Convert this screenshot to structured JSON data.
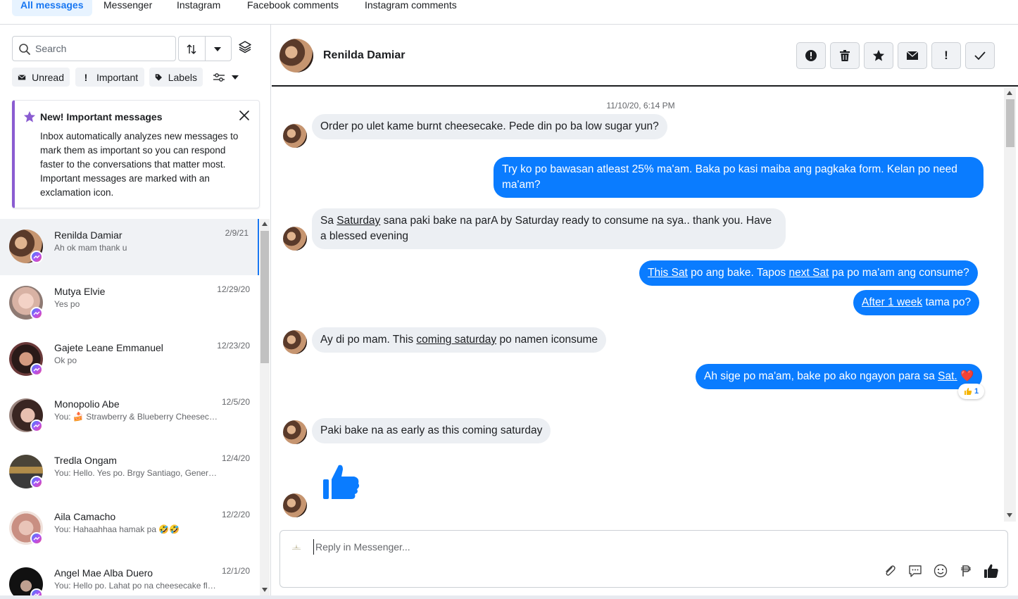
{
  "tabs": [
    "All messages",
    "Messenger",
    "Instagram",
    "Facebook comments",
    "Instagram comments"
  ],
  "search": {
    "placeholder": "Search"
  },
  "filters": {
    "unread": "Unread",
    "important": "Important",
    "labels": "Labels"
  },
  "banner": {
    "title": "New! Important messages",
    "text": "Inbox automatically analyzes new messages to mark them as important so you can respond faster to the conversations that matter most. Important messages are marked with an exclamation icon."
  },
  "conversations": [
    {
      "name": "Renilda Damiar",
      "preview": "Ah ok mam thank u",
      "date": "2/9/21"
    },
    {
      "name": "Mutya Elvie",
      "preview": "Yes po",
      "date": "12/29/20"
    },
    {
      "name": "Gajete Leane Emmanuel",
      "preview": "Ok po",
      "date": "12/23/20"
    },
    {
      "name": "Monopolio Abe",
      "preview": "You: 🍰 Strawberry & Blueberry Cheesecake",
      "date": "12/5/20"
    },
    {
      "name": "Tredla Ongam",
      "preview": "You: Hello. Yes po. Brgy Santiago, General Trias",
      "date": "12/4/20"
    },
    {
      "name": "Aila Camacho",
      "preview": "You: Hahaahhaa hamak pa 🤣🤣",
      "date": "12/2/20"
    },
    {
      "name": "Angel Mae Alba Duero",
      "preview": "You: Hello po. Lahat po na cheesecake flavors",
      "date": "12/1/20"
    }
  ],
  "header": {
    "name": "Renilda Damiar"
  },
  "thread": {
    "timestamp": "11/10/20, 6:14 PM",
    "m1": "Order po ulet kame burnt cheesecake. Pede din po ba low sugar yun?",
    "m2": "Try ko po bawasan atleast 25% ma'am. Baka po kasi maiba ang pagkaka form. Kelan po need ma'am?",
    "m3a": "Sa ",
    "m3b": "Saturday",
    "m3c": " sana paki bake na parA by Saturday ready to consume na sya.. thank you. Have a blessed evening",
    "m4a": "This Sat",
    "m4b": " po ang bake. Tapos ",
    "m4c": "next Sat",
    "m4d": " pa po ma'am ang consume?",
    "m5a": "After 1 week",
    "m5b": " tama po?",
    "m6a": "Ay di po mam. This ",
    "m6b": "coming saturday",
    "m6c": " po namen iconsume",
    "m7a": "Ah sige po ma'am, bake po ako ngayon para sa ",
    "m7b": "Sat.",
    "m7c": " ❤️",
    "reaction_count": "1",
    "m8": "Paki bake na  as early as this coming  saturday"
  },
  "composer": {
    "placeholder": "Reply in Messenger..."
  },
  "colors": {
    "accent": "#1877f2",
    "out_bubble": "#0a7cff",
    "in_bubble": "#eceff3",
    "banner_accent": "#8a5cd1"
  }
}
